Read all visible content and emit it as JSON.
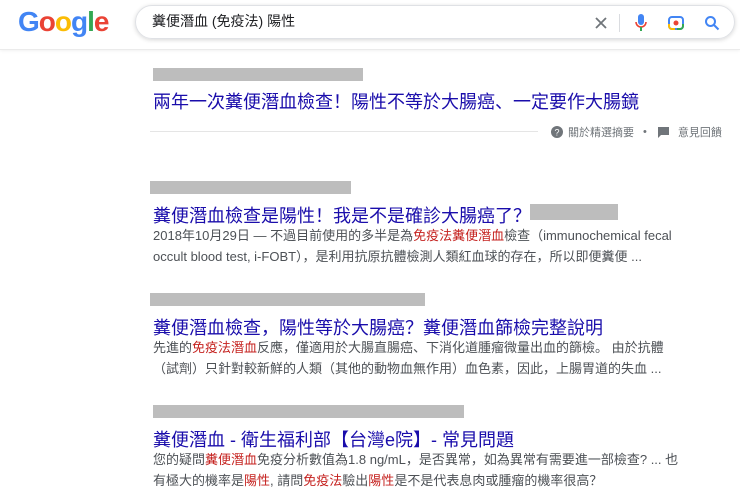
{
  "logo": {
    "letters": [
      "G",
      "o",
      "o",
      "g",
      "l",
      "e"
    ],
    "colors": [
      "#4285f4",
      "#ea4335",
      "#fbbc05",
      "#4285f4",
      "#34a853",
      "#ea4335"
    ]
  },
  "search": {
    "query": "糞便潛血 (免疫法) 陽性"
  },
  "featured": {
    "title": "兩年一次糞便潛血檢查！陽性不等於大腸癌、一定要作大腸鏡",
    "about_label": "關於精選摘要",
    "feedback_label": "意見回饋"
  },
  "results": [
    {
      "title": "糞便潛血檢查是陽性！我是不是確診大腸癌了？ -",
      "snippet": [
        {
          "t": "2018年10月29日 — 不過目前使用的多半是為"
        },
        {
          "t": "免疫法糞便潛血",
          "hl": true
        },
        {
          "t": "檢查（immunochemical fecal occult blood test, i-FOBT），是利用抗原抗體檢測人類紅血球的存在，所以即便糞便 ..."
        }
      ]
    },
    {
      "title": "糞便潛血檢查，陽性等於大腸癌？糞便潛血篩檢完整說明",
      "snippet": [
        {
          "t": "先進的"
        },
        {
          "t": "免疫法潛血",
          "hl": true
        },
        {
          "t": "反應，僅適用於大腸直腸癌、下消化道腫瘤微量出血的篩檢。 由於抗體（試劑）只針對較新鮮的人類（其他的動物血無作用）血色素，因此，上腸胃道的失血 ..."
        }
      ]
    },
    {
      "title": "糞便潛血 - 衛生福利部【台灣e院】- 常見問題",
      "snippet": [
        {
          "t": "您的疑問"
        },
        {
          "t": "糞便潛血",
          "hl": true
        },
        {
          "t": "免疫分析數值為1.8 ng/mL，是否異常，如為異常有需要進一部檢查? ... 也有極大的機率是"
        },
        {
          "t": "陽性",
          "hl": true
        },
        {
          "t": ", 請問"
        },
        {
          "t": "免疫法",
          "hl": true
        },
        {
          "t": "驗出"
        },
        {
          "t": "陽性",
          "hl": true
        },
        {
          "t": "是不是代表息肉或腫瘤的機率很高？"
        }
      ]
    }
  ]
}
